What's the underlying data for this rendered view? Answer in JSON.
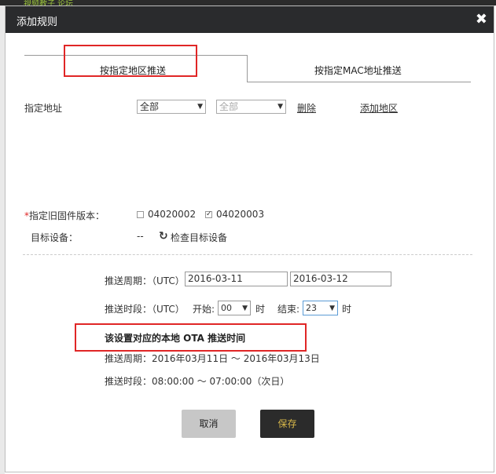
{
  "background": {
    "top_text": "視频教子    论坛"
  },
  "dialog": {
    "title": "添加规则"
  },
  "tabs": [
    {
      "label": "按指定地区推送"
    },
    {
      "label": "按指定MAC地址推送"
    }
  ],
  "region": {
    "label": "指定地址",
    "select1_value": "全部",
    "select2_value": "全部",
    "delete_link": "删除",
    "add_link": "添加地区"
  },
  "firmware": {
    "required_mark": "*",
    "label": "指定旧固件版本：",
    "options": [
      {
        "label": "04020002",
        "checked": false
      },
      {
        "label": "04020003",
        "checked": true
      }
    ]
  },
  "target": {
    "label": "目标设备：",
    "value": "--",
    "check_button": "检查目标设备"
  },
  "push_period": {
    "label": "推送周期：（UTC）",
    "start": "2016-03-11",
    "end": "2016-03-12"
  },
  "push_time": {
    "label": "推送时段：（UTC）",
    "start_label": "开始:",
    "start_value": "00",
    "start_unit": "时",
    "end_label": "结束:",
    "end_value": "23",
    "end_unit": "时"
  },
  "local": {
    "title": "该设置对应的本地 OTA 推送时间",
    "period": "推送周期：2016年03月11日  ～  2016年03月13日",
    "time": "推送时段：08:00:00  ～  07:00:00（次日）"
  },
  "buttons": {
    "cancel": "取消",
    "save": "保存"
  },
  "colors": {
    "titlebar": "#2a2b2d",
    "highlight": "#e02626",
    "save_text": "#d9b84a"
  },
  "icons": {
    "close": "close-icon",
    "refresh": "refresh-icon",
    "dropdown": "chevron-down-icon"
  }
}
